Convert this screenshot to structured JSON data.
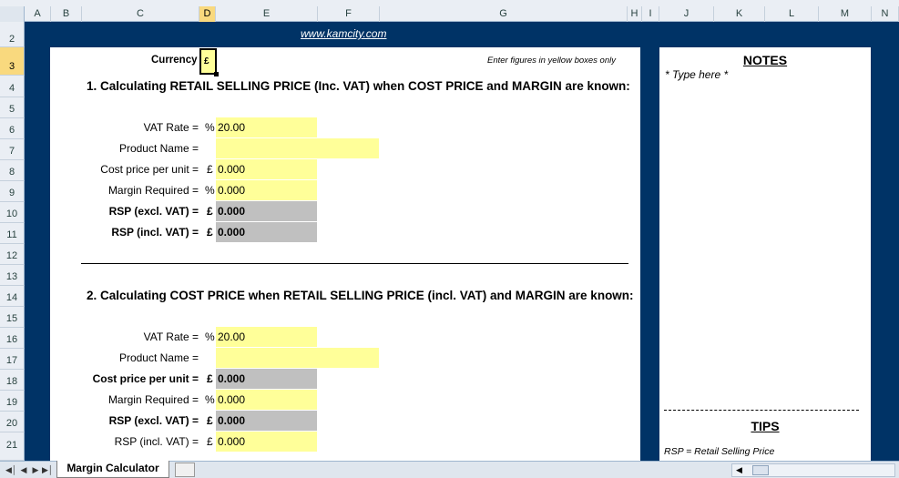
{
  "columns": [
    {
      "label": "A"
    },
    {
      "label": "B"
    },
    {
      "label": "C"
    },
    {
      "label": "D"
    },
    {
      "label": "E"
    },
    {
      "label": "F"
    },
    {
      "label": "G"
    },
    {
      "label": "H"
    },
    {
      "label": "I"
    },
    {
      "label": "J"
    },
    {
      "label": "K"
    },
    {
      "label": "L"
    },
    {
      "label": "M"
    },
    {
      "label": "N"
    }
  ],
  "active_column": "D",
  "active_row": "3",
  "rows": [
    "2",
    "3",
    "4",
    "5",
    "6",
    "7",
    "8",
    "9",
    "10",
    "11",
    "12",
    "13",
    "14",
    "15",
    "16",
    "17",
    "18",
    "19",
    "20",
    "21"
  ],
  "url": "www.kamcity.com",
  "currency": {
    "label": "Currency",
    "value": "£"
  },
  "instruction": "Enter figures in yellow boxes only",
  "section1": {
    "heading": "1. Calculating RETAIL SELLING PRICE (Inc. VAT) when COST PRICE and MARGIN are known:",
    "vat_label": "VAT Rate =",
    "vat_sym": "%",
    "vat_value": "20.00",
    "product_label": "Product Name =",
    "product_value": "",
    "cost_label": "Cost price per unit =",
    "cost_sym": "£",
    "cost_value": "0.000",
    "margin_label": "Margin Required =",
    "margin_sym": "%",
    "margin_value": "0.000",
    "rsp_ex_label": "RSP (excl. VAT) =",
    "rsp_ex_sym": "£",
    "rsp_ex_value": "0.000",
    "rsp_inc_label": "RSP (incl. VAT) =",
    "rsp_inc_sym": "£",
    "rsp_inc_value": "0.000"
  },
  "section2": {
    "heading": "2. Calculating COST PRICE when RETAIL SELLING PRICE (incl. VAT) and MARGIN are known:",
    "vat_label": "VAT Rate =",
    "vat_sym": "%",
    "vat_value": "20.00",
    "product_label": "Product Name =",
    "product_value": "",
    "cost_label": "Cost price per unit =",
    "cost_sym": "£",
    "cost_value": "0.000",
    "margin_label": "Margin Required =",
    "margin_sym": "%",
    "margin_value": "0.000",
    "rsp_ex_label": "RSP (excl. VAT) =",
    "rsp_ex_sym": "£",
    "rsp_ex_value": "0.000",
    "rsp_inc_label": "RSP (incl. VAT) =",
    "rsp_inc_sym": "£",
    "rsp_inc_value": "0.000"
  },
  "notes": {
    "title": "NOTES",
    "placeholder": "* Type here *"
  },
  "tips": {
    "title": "TIPS",
    "line1": "RSP = Retail Selling Price"
  },
  "sheet_tab": "Margin Calculator",
  "colors": {
    "navy": "#003366",
    "input": "#ffff99",
    "output": "#c0c0c0"
  }
}
